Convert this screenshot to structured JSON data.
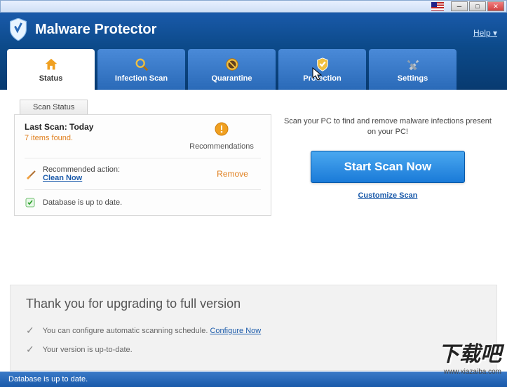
{
  "app": {
    "title": "Malware Protector",
    "help": "Help"
  },
  "tabs": [
    {
      "label": "Status"
    },
    {
      "label": "Infection Scan"
    },
    {
      "label": "Quarantine"
    },
    {
      "label": "Protection"
    },
    {
      "label": "Settings"
    }
  ],
  "scan_status": {
    "tab_label": "Scan Status",
    "last_scan_label": "Last Scan: Today",
    "items_found": "7 items found.",
    "recommendations_label": "Recommendations",
    "recommended_action_label": "Recommended action:",
    "clean_now": "Clean Now",
    "remove": "Remove",
    "database_status": "Database is up to date."
  },
  "right": {
    "desc": "Scan your PC to find and remove malware infections present on your PC!",
    "start_button": "Start Scan Now",
    "customize": "Customize Scan"
  },
  "upgrade": {
    "title": "Thank you for upgrading to full version",
    "line1_text": "You can configure automatic scanning schedule.",
    "line1_link": "Configure Now",
    "line2_text": "Your version is up-to-date."
  },
  "statusbar": {
    "text": "Database is up to date."
  },
  "watermark": {
    "cn": "下载吧",
    "url": "www.xiazaiba.com"
  }
}
